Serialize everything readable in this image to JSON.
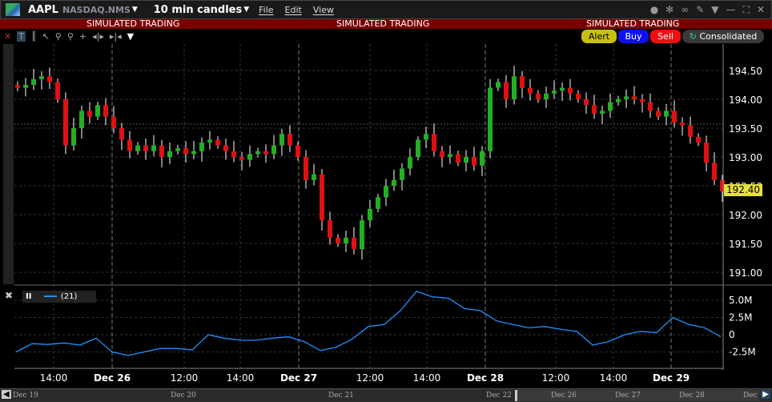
{
  "header": {
    "symbol": "AAPL",
    "exchange": "NASDAQ.NMS",
    "interval": "10 min candles",
    "menu": [
      "File",
      "Edit",
      "View"
    ]
  },
  "sim_banner": [
    "SIMULATED TRADING",
    "SIMULATED TRADING",
    "SIMULATED TRADING"
  ],
  "buttons": {
    "alert": "Alert",
    "buy": "Buy",
    "sell": "Sell",
    "consolidated": "Consolidated"
  },
  "colors": {
    "up": "#22b022",
    "down": "#e01010",
    "line": "#1e90ff",
    "price_tag": "#e6e03c"
  },
  "indicator": {
    "name": "II",
    "param": "(21)"
  },
  "last_price": "192.40",
  "chart_data": {
    "type": "candlestick",
    "price_ticks": [
      "194.50",
      "194.00",
      "193.50",
      "193.00",
      "192.50",
      "192.00",
      "191.50",
      "191.00"
    ],
    "price_range": [
      190.8,
      194.9
    ],
    "closes": [
      194.2,
      194.25,
      194.35,
      194.4,
      194.3,
      194.0,
      193.2,
      193.5,
      193.8,
      193.7,
      193.9,
      193.7,
      193.5,
      193.3,
      193.1,
      193.2,
      193.1,
      193.2,
      193.0,
      193.1,
      193.15,
      193.05,
      193.1,
      193.25,
      193.3,
      193.2,
      193.1,
      193.0,
      192.95,
      193.05,
      193.1,
      193.05,
      193.2,
      193.4,
      193.2,
      193.0,
      192.6,
      192.7,
      191.9,
      191.6,
      191.5,
      191.6,
      191.4,
      191.9,
      192.1,
      192.3,
      192.5,
      192.6,
      192.8,
      193.0,
      193.3,
      193.4,
      193.1,
      193.0,
      193.05,
      192.9,
      193.0,
      192.85,
      193.1,
      194.2,
      194.3,
      194.0,
      194.4,
      194.2,
      194.1,
      194.0,
      194.1,
      194.15,
      194.2,
      194.1,
      194.0,
      193.9,
      193.75,
      193.8,
      193.95,
      194.0,
      194.05,
      194.0,
      193.95,
      193.8,
      193.7,
      193.8,
      193.6,
      193.55,
      193.35,
      193.25,
      192.9,
      192.6,
      192.4
    ],
    "indicator_ticks": [
      "5.0M",
      "2.5M",
      "0",
      "-2.5M"
    ],
    "indicator_values_M": [
      -2.5,
      -1.3,
      -1.4,
      -1.2,
      -1.5,
      -0.5,
      -2.5,
      -3.0,
      -2.5,
      -2.0,
      -2.0,
      -2.2,
      0,
      -0.5,
      -0.8,
      -0.8,
      -0.5,
      -0.3,
      -1.0,
      -2.3,
      -1.8,
      -0.6,
      1.2,
      1.5,
      3.5,
      6.3,
      5.5,
      5.3,
      3.8,
      3.5,
      2.0,
      1.5,
      1.0,
      1.2,
      0.8,
      0.5,
      -1.5,
      -1.0,
      0.0,
      0.5,
      0.3,
      2.5,
      1.5,
      1.0,
      -0.3
    ],
    "time_labels": [
      {
        "t": "14:00",
        "bold": false
      },
      {
        "t": "Dec 26",
        "bold": true
      },
      {
        "t": "12:00",
        "bold": false
      },
      {
        "t": "14:00",
        "bold": false
      },
      {
        "t": "Dec 27",
        "bold": true
      },
      {
        "t": "12:00",
        "bold": false
      },
      {
        "t": "14:00",
        "bold": false
      },
      {
        "t": "Dec 28",
        "bold": true
      },
      {
        "t": "12:00",
        "bold": false
      },
      {
        "t": "14:00",
        "bold": false
      },
      {
        "t": "Dec 29",
        "bold": true
      }
    ]
  },
  "navigator": [
    "Dec 19",
    "Dec 20",
    "Dec 21",
    "Dec 22",
    "Dec 26",
    "Dec 27",
    "Dec 28",
    "Dec"
  ]
}
